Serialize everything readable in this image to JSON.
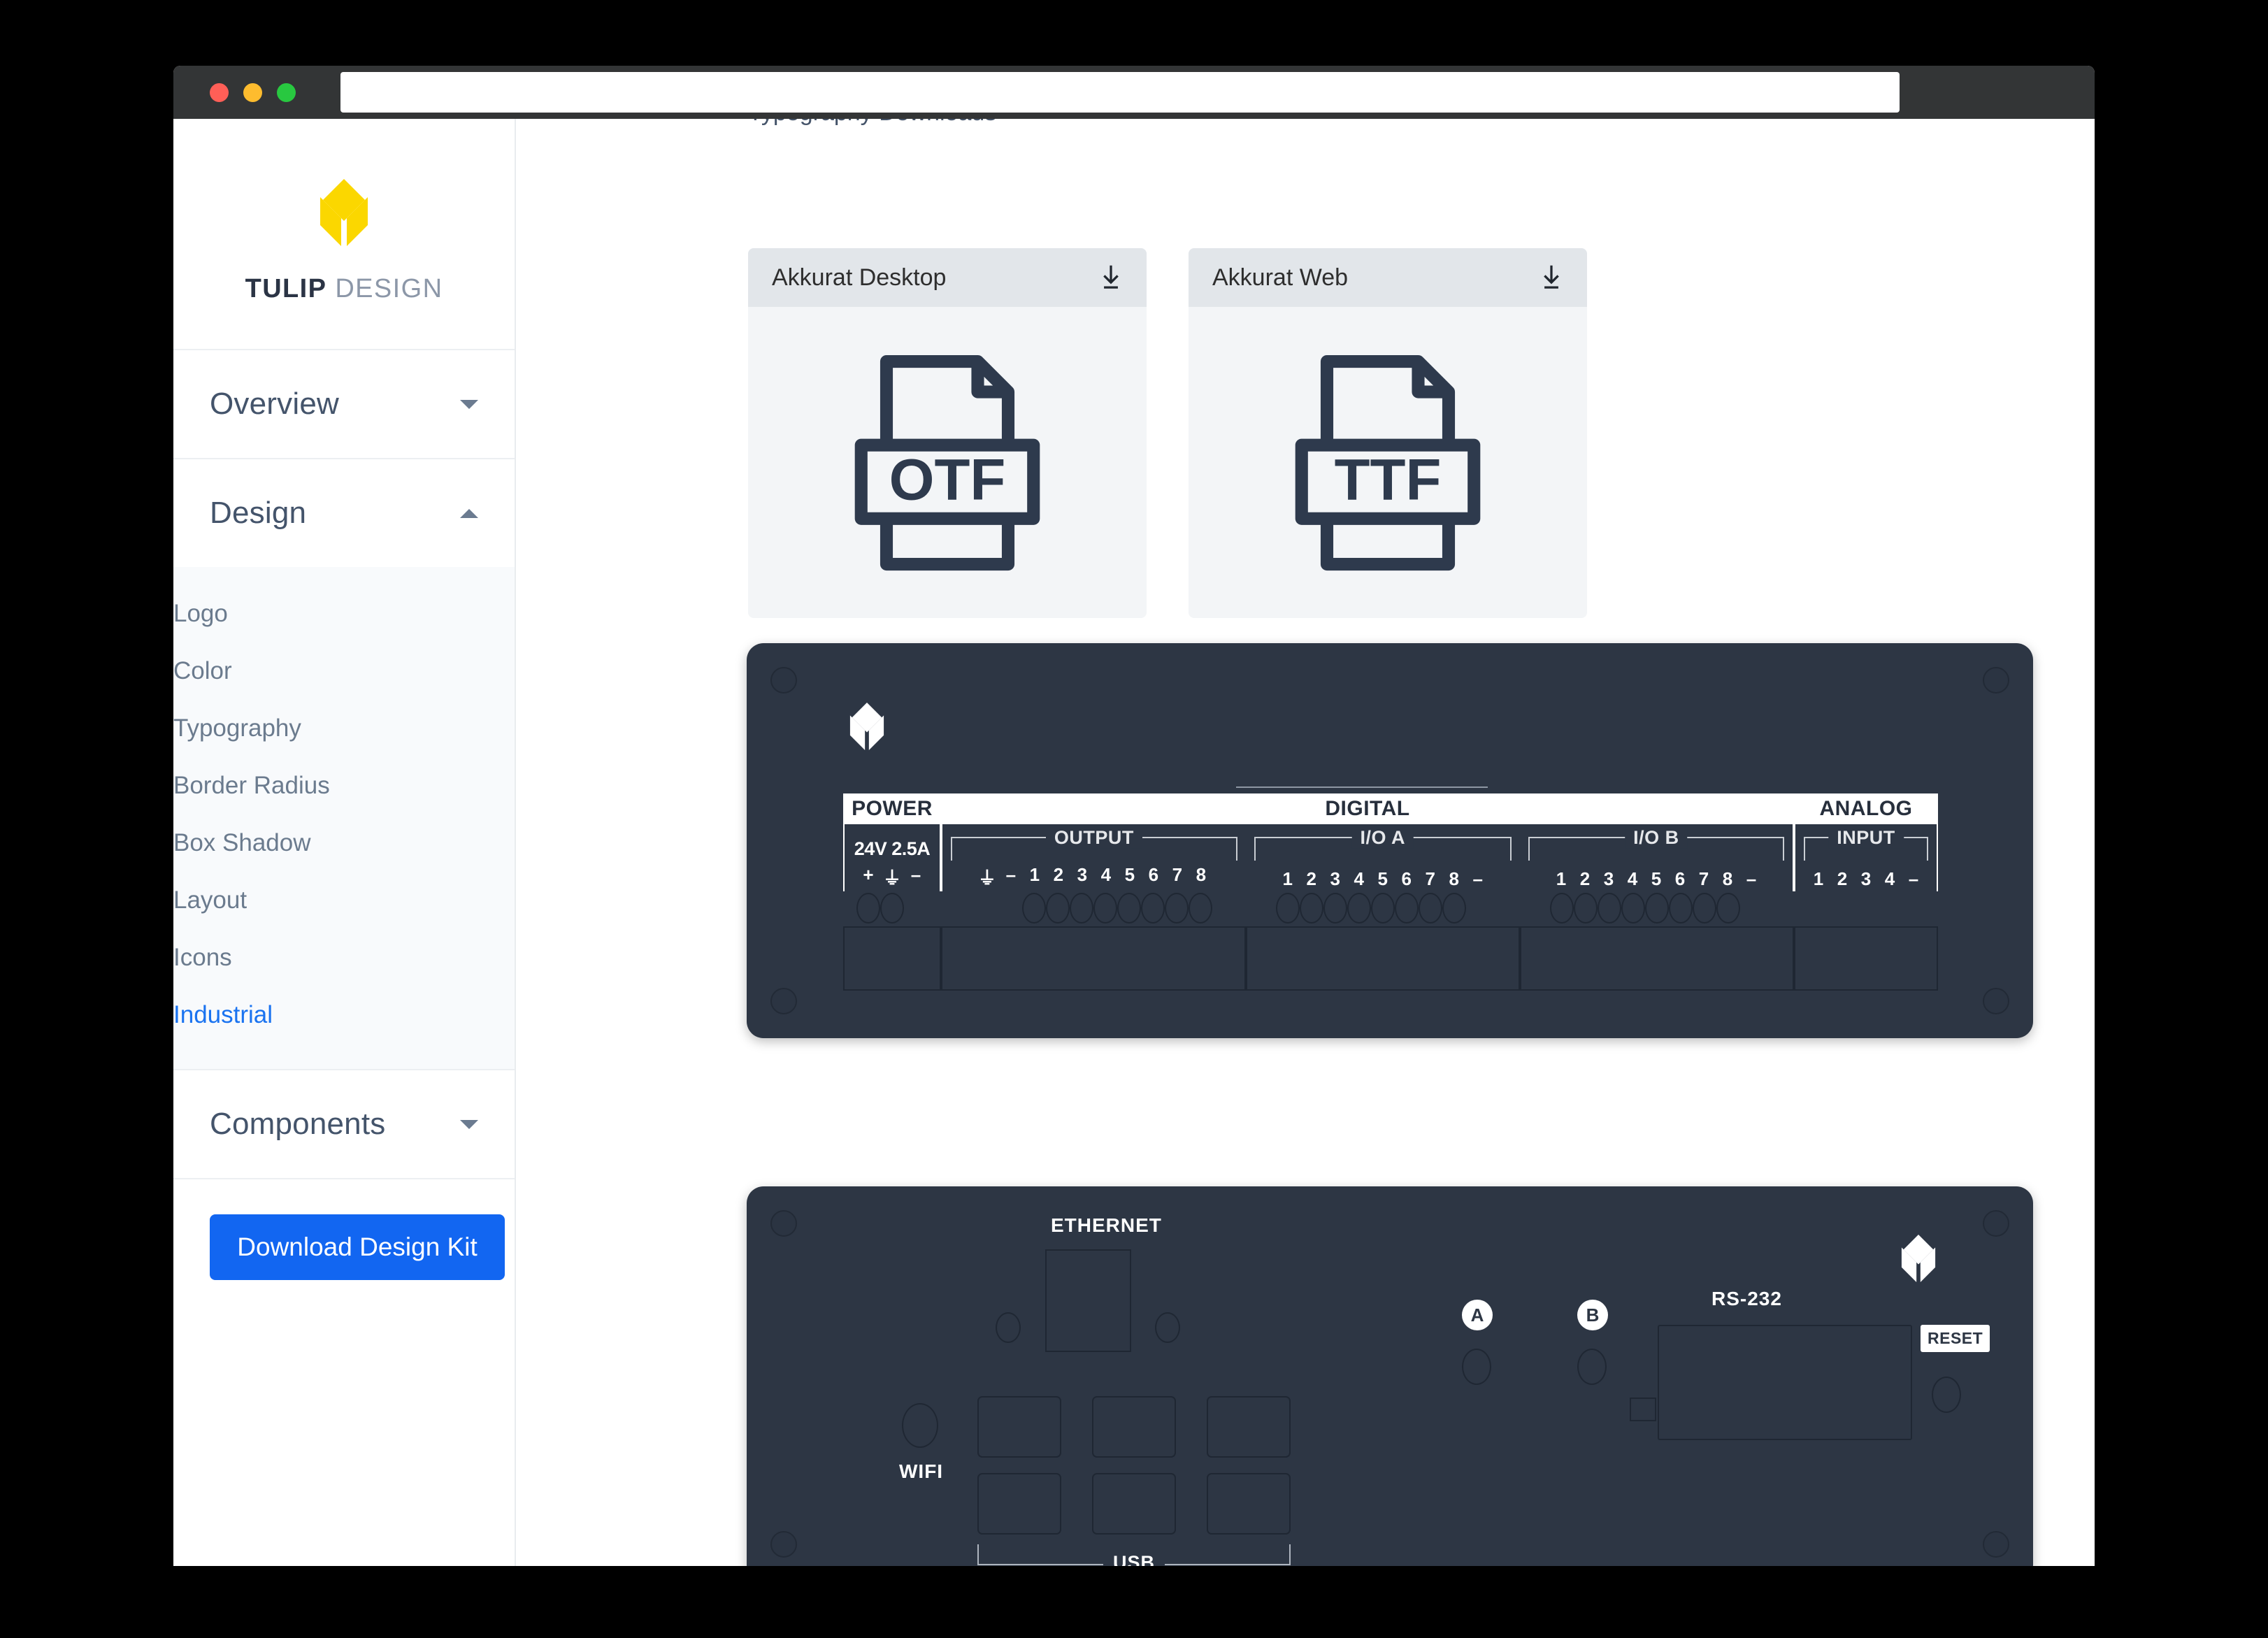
{
  "window": {
    "traffic_lights": [
      "close",
      "minimize",
      "maximize"
    ],
    "url_value": "",
    "url_placeholder": ""
  },
  "sidebar": {
    "brand": {
      "name_bold": "TULIP",
      "name_light": "DESIGN",
      "logo": "tulip-logo"
    },
    "groups": [
      {
        "label": "Overview",
        "expanded": false,
        "caret": "chevron-down-icon",
        "items": []
      },
      {
        "label": "Design",
        "expanded": true,
        "caret": "chevron-up-icon",
        "items": [
          {
            "label": "Logo",
            "active": false
          },
          {
            "label": "Color",
            "active": false
          },
          {
            "label": "Typography",
            "active": false
          },
          {
            "label": "Border Radius",
            "active": false
          },
          {
            "label": "Box Shadow",
            "active": false
          },
          {
            "label": "Layout",
            "active": false
          },
          {
            "label": "Icons",
            "active": false
          },
          {
            "label": "Industrial",
            "active": true
          }
        ]
      },
      {
        "label": "Components",
        "expanded": false,
        "caret": "chevron-down-icon",
        "items": []
      }
    ],
    "download_button": "Download Design Kit"
  },
  "main": {
    "clipped_heading": "Typography Downloads",
    "font_cards": [
      {
        "title": "Akkurat Desktop",
        "format": "OTF",
        "download_icon": "download-icon"
      },
      {
        "title": "Akkurat Web",
        "format": "TTF",
        "download_icon": "download-icon"
      }
    ],
    "front_panel": {
      "logo": "tulip-logo-white",
      "groups": [
        {
          "label": "POWER",
          "rating": "24V 2.5A",
          "sub": null,
          "pins": [
            "+",
            "⏚",
            "–"
          ]
        },
        {
          "label": "DIGITAL",
          "subgroups": [
            {
              "label": "OUTPUT",
              "pins": [
                "⏚",
                "–",
                "1",
                "2",
                "3",
                "4",
                "5",
                "6",
                "7",
                "8"
              ]
            },
            {
              "label": "I/O  A",
              "pins": [
                "1",
                "2",
                "3",
                "4",
                "5",
                "6",
                "7",
                "8",
                "–"
              ]
            },
            {
              "label": "I/O  B",
              "pins": [
                "1",
                "2",
                "3",
                "4",
                "5",
                "6",
                "7",
                "8",
                "–"
              ]
            }
          ]
        },
        {
          "label": "ANALOG",
          "subgroups": [
            {
              "label": "INPUT",
              "pins": [
                "1",
                "2",
                "3",
                "4",
                "–"
              ]
            }
          ]
        }
      ]
    },
    "back_panel": {
      "logo": "tulip-logo-white",
      "ethernet_label": "ETHERNET",
      "wifi_label": "WIFI",
      "usb_label": "USB",
      "rs232_label": "RS-232",
      "reset_label": "RESET",
      "antenna_badges": [
        "A",
        "B"
      ]
    }
  },
  "colors": {
    "brand_yellow": "#FBD700",
    "accent_blue": "#1266F1",
    "panel_dark": "#2D3644",
    "ink": "#2E3A4D",
    "card_bg": "#F3F5F7",
    "card_head": "#E2E6EA"
  }
}
